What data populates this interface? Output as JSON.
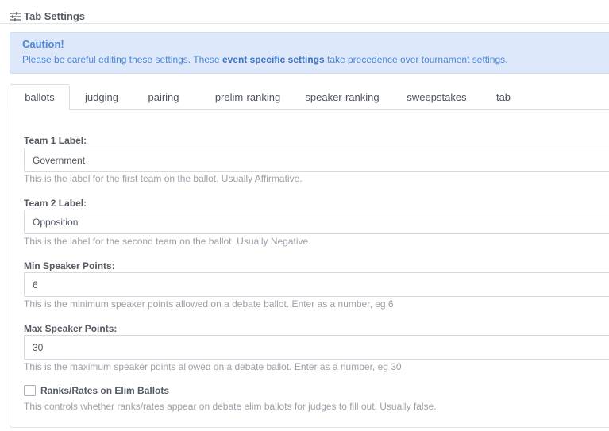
{
  "header": {
    "title": "Tab Settings",
    "icon": "sliders-icon"
  },
  "caution": {
    "title": "Caution!",
    "body_before": "Please be careful editing these settings. These ",
    "body_bold": "event specific settings",
    "body_after": " take precedence over tournament settings."
  },
  "tabs": [
    {
      "label": "ballots",
      "active": true
    },
    {
      "label": "judging",
      "active": false
    },
    {
      "label": "pairing",
      "active": false
    },
    {
      "label": "prelim-ranking",
      "active": false
    },
    {
      "label": "speaker-ranking",
      "active": false
    },
    {
      "label": "sweepstakes",
      "active": false
    },
    {
      "label": "tab",
      "active": false
    }
  ],
  "fields": [
    {
      "label": "Team 1 Label:",
      "value": "Government",
      "help": "This is the label for the first team on the ballot. Usually Affirmative."
    },
    {
      "label": "Team 2 Label:",
      "value": "Opposition",
      "help": "This is the label for the second team on the ballot. Usually Negative."
    },
    {
      "label": "Min Speaker Points:",
      "value": "6",
      "help": "This is the minimum speaker points allowed on a debate ballot. Enter as a number, eg 6"
    },
    {
      "label": "Max Speaker Points:",
      "value": "30",
      "help": "This is the maximum speaker points allowed on a debate ballot. Enter as a number, eg 30"
    }
  ],
  "elim_ranks": {
    "label": "Ranks/Rates on Elim Ballots",
    "checked": false,
    "help": "This controls whether ranks/rates appear on debate elim ballots for judges to fill out. Usually false."
  },
  "colors": {
    "caution_bg": "#dde9fb",
    "caution_text": "#4d86d9",
    "help_text": "#9aa1a9"
  }
}
